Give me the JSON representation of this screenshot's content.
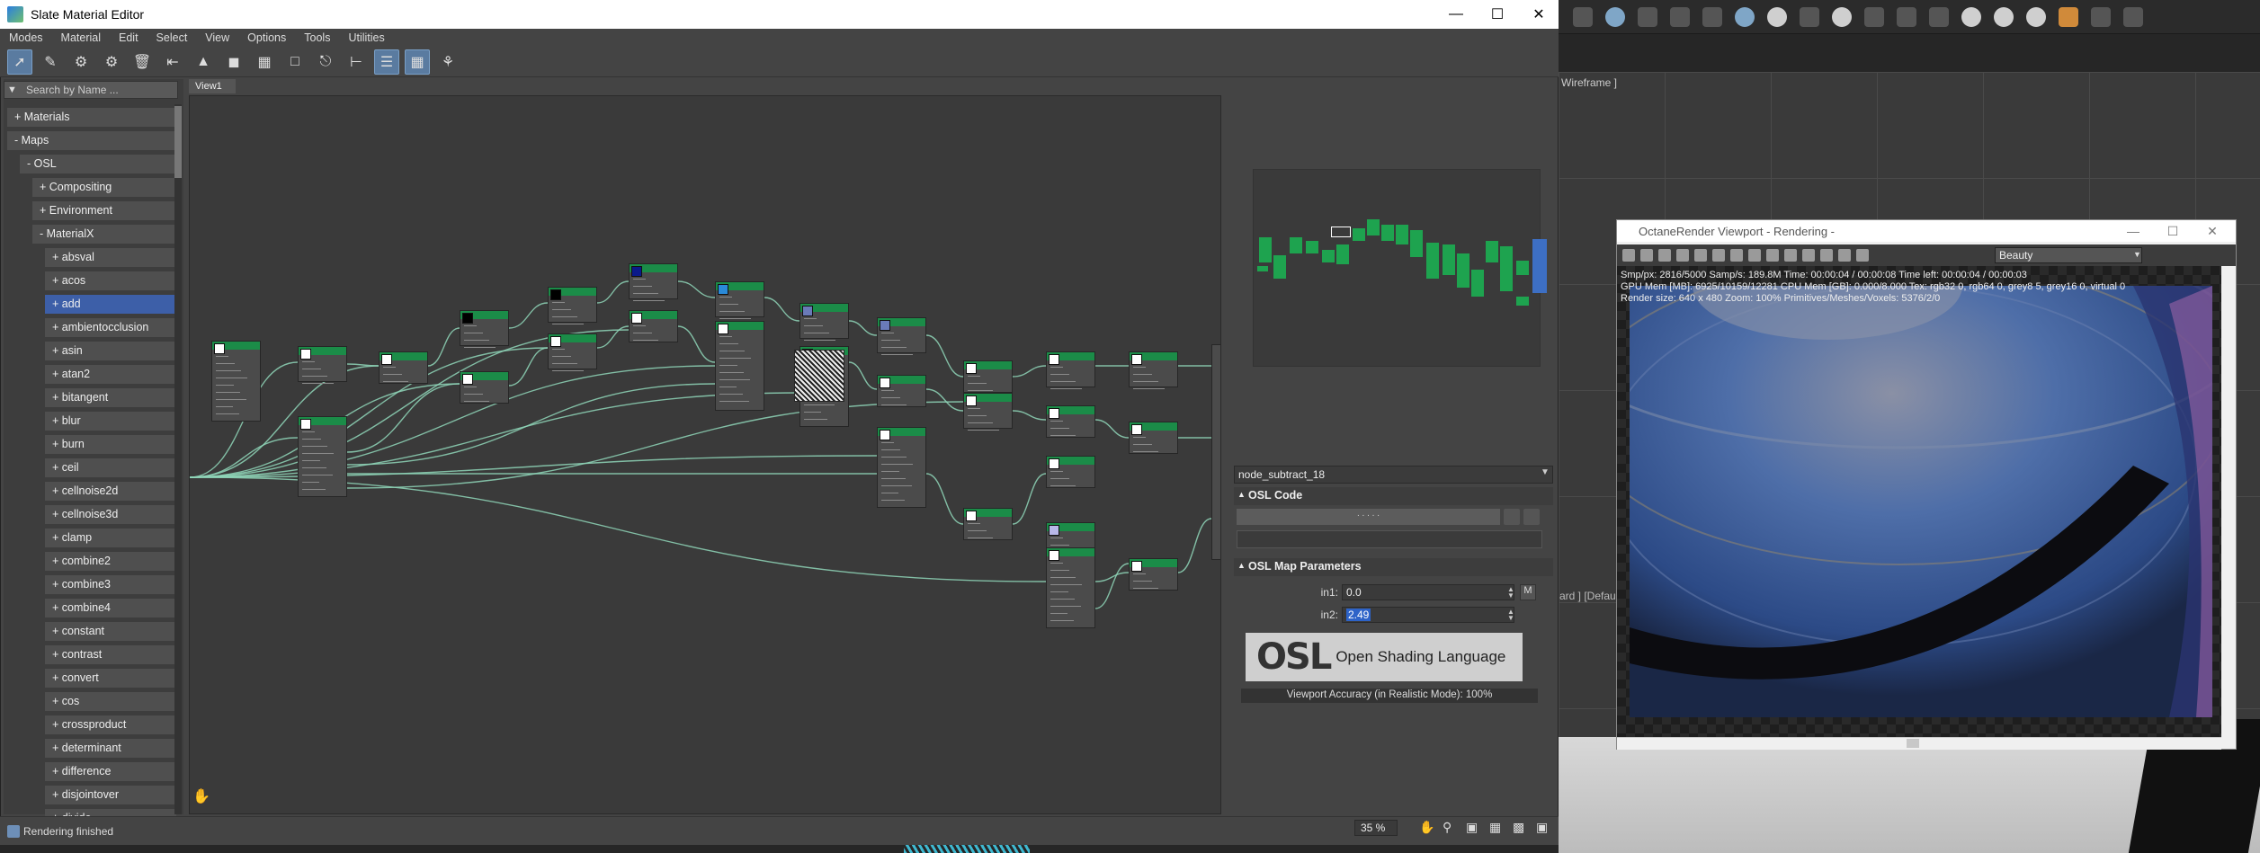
{
  "window": {
    "title": "Slate Material Editor"
  },
  "menu": [
    "Modes",
    "Material",
    "Edit",
    "Select",
    "View",
    "Options",
    "Tools",
    "Utilities"
  ],
  "browser": {
    "search_placeholder": "Search by Name ...",
    "items": [
      {
        "label": "+ Materials",
        "indent": 0
      },
      {
        "label": "- Maps",
        "indent": 0
      },
      {
        "label": "- OSL",
        "indent": 1
      },
      {
        "label": "+ Compositing",
        "indent": 2
      },
      {
        "label": "+ Environment",
        "indent": 2
      },
      {
        "label": "- MaterialX",
        "indent": 2
      },
      {
        "label": "+ absval",
        "indent": 3
      },
      {
        "label": "+ acos",
        "indent": 3
      },
      {
        "label": "+ add",
        "indent": 3,
        "selected": true
      },
      {
        "label": "+ ambientocclusion",
        "indent": 3
      },
      {
        "label": "+ asin",
        "indent": 3
      },
      {
        "label": "+ atan2",
        "indent": 3
      },
      {
        "label": "+ bitangent",
        "indent": 3
      },
      {
        "label": "+ blur",
        "indent": 3
      },
      {
        "label": "+ burn",
        "indent": 3
      },
      {
        "label": "+ ceil",
        "indent": 3
      },
      {
        "label": "+ cellnoise2d",
        "indent": 3
      },
      {
        "label": "+ cellnoise3d",
        "indent": 3
      },
      {
        "label": "+ clamp",
        "indent": 3
      },
      {
        "label": "+ combine2",
        "indent": 3
      },
      {
        "label": "+ combine3",
        "indent": 3
      },
      {
        "label": "+ combine4",
        "indent": 3
      },
      {
        "label": "+ constant",
        "indent": 3
      },
      {
        "label": "+ contrast",
        "indent": 3
      },
      {
        "label": "+ convert",
        "indent": 3
      },
      {
        "label": "+ cos",
        "indent": 3
      },
      {
        "label": "+ crossproduct",
        "indent": 3
      },
      {
        "label": "+ determinant",
        "indent": 3
      },
      {
        "label": "+ difference",
        "indent": 3
      },
      {
        "label": "+ disjointover",
        "indent": 3
      },
      {
        "label": "+ divide",
        "indent": 3
      }
    ]
  },
  "view": {
    "tab": "View1"
  },
  "params": {
    "node_name": "node_subtract_18",
    "osl_code_title": "OSL Code",
    "osl_code_placeholder": ". . . . .",
    "map_params_title": "OSL Map Parameters",
    "in1_label": "in1:",
    "in1_value": "0.0",
    "in2_label": "in2:",
    "in2_value": "2.49",
    "m_button": "M",
    "osl_logo_text": "OSL",
    "osl_logo_sub": "Open Shading Language",
    "accuracy": "Viewport Accuracy (in Realistic Mode): 100%"
  },
  "status": {
    "text": "Rendering finished",
    "zoom": "35 %"
  },
  "background": {
    "viewport_label": "Wireframe ]",
    "left_label": "ard ] [Defau"
  },
  "octane": {
    "title": "OctaneRender Viewport - Rendering -",
    "pass": "Beauty",
    "stats_line1": "Smp/px: 2816/5000    Samp/s: 189.8M    Time: 00:00:04 / 00:00:08    Time left: 00:00:04 / 00:00:03",
    "stats_line2": "GPU Mem [MB]: 6925/10159/12281    CPU Mem [GB]: 0.000/8.000    Tex: rgb32 0, rgb64 0, grey8 5, grey16 0, virtual 0",
    "stats_line3": "Render size: 640 x 480    Zoom: 100%    Primitives/Meshes/Voxels: 5376/2/0"
  },
  "colors": {
    "accent": "#3d5fa8",
    "node_header": "#1b8c48",
    "selection": "#2d63c8"
  }
}
